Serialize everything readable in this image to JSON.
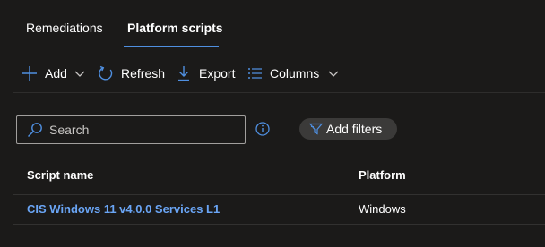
{
  "tabs": [
    {
      "label": "Remediations",
      "active": false
    },
    {
      "label": "Platform scripts",
      "active": true
    }
  ],
  "toolbar": {
    "add_label": "Add",
    "refresh_label": "Refresh",
    "export_label": "Export",
    "columns_label": "Columns"
  },
  "search": {
    "placeholder": "Search",
    "value": ""
  },
  "filters": {
    "label": "Add filters"
  },
  "table": {
    "columns": [
      "Script name",
      "Platform"
    ],
    "rows": [
      {
        "script_name": "CIS Windows 11 v4.0.0 Services L1",
        "platform": "Windows"
      }
    ]
  },
  "colors": {
    "background": "#1b1a19",
    "accent": "#4f8fe0",
    "link": "#6aa5f5",
    "pill": "#3b3a39"
  },
  "icons": [
    "plus-icon",
    "chevron-down-icon",
    "refresh-icon",
    "download-icon",
    "columns-list-icon",
    "search-icon",
    "info-icon",
    "filter-icon"
  ]
}
